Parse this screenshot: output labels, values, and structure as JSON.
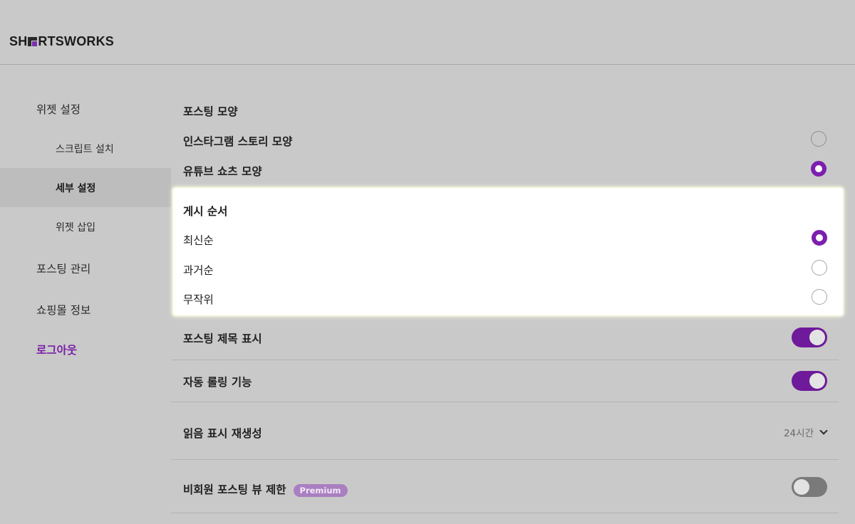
{
  "brand": {
    "logo_prefix": "SH",
    "logo_suffix": "RTSWORKS",
    "accent": "#7c1fae"
  },
  "sidebar": {
    "items": [
      {
        "label": "위젯 설정"
      },
      {
        "label": "스크립트 설치"
      },
      {
        "label": "세부 설정"
      },
      {
        "label": "위젯 삽입"
      },
      {
        "label": "포스팅 관리"
      },
      {
        "label": "쇼핑몰 정보"
      },
      {
        "label": "로그아웃"
      }
    ]
  },
  "settings": {
    "posting_shape": {
      "title": "포스팅 모양",
      "options": [
        {
          "label": "인스타그램 스토리 모양",
          "selected": false
        },
        {
          "label": "유튜브 쇼츠 모양",
          "selected": true
        }
      ]
    },
    "post_order": {
      "title": "게시 순서",
      "options": [
        {
          "label": "최신순",
          "selected": true
        },
        {
          "label": "과거순",
          "selected": false
        },
        {
          "label": "무작위",
          "selected": false
        }
      ]
    },
    "show_title": {
      "label": "포스팅 제목 표시",
      "enabled": true
    },
    "auto_rolling": {
      "label": "자동 롤링 기능",
      "enabled": true
    },
    "read_regen": {
      "label": "읽음 표시 재생성",
      "value": "24시간"
    },
    "guest_limit": {
      "label": "비회원 포스팅 뷰 제한",
      "badge": "Premium",
      "enabled": false
    }
  }
}
